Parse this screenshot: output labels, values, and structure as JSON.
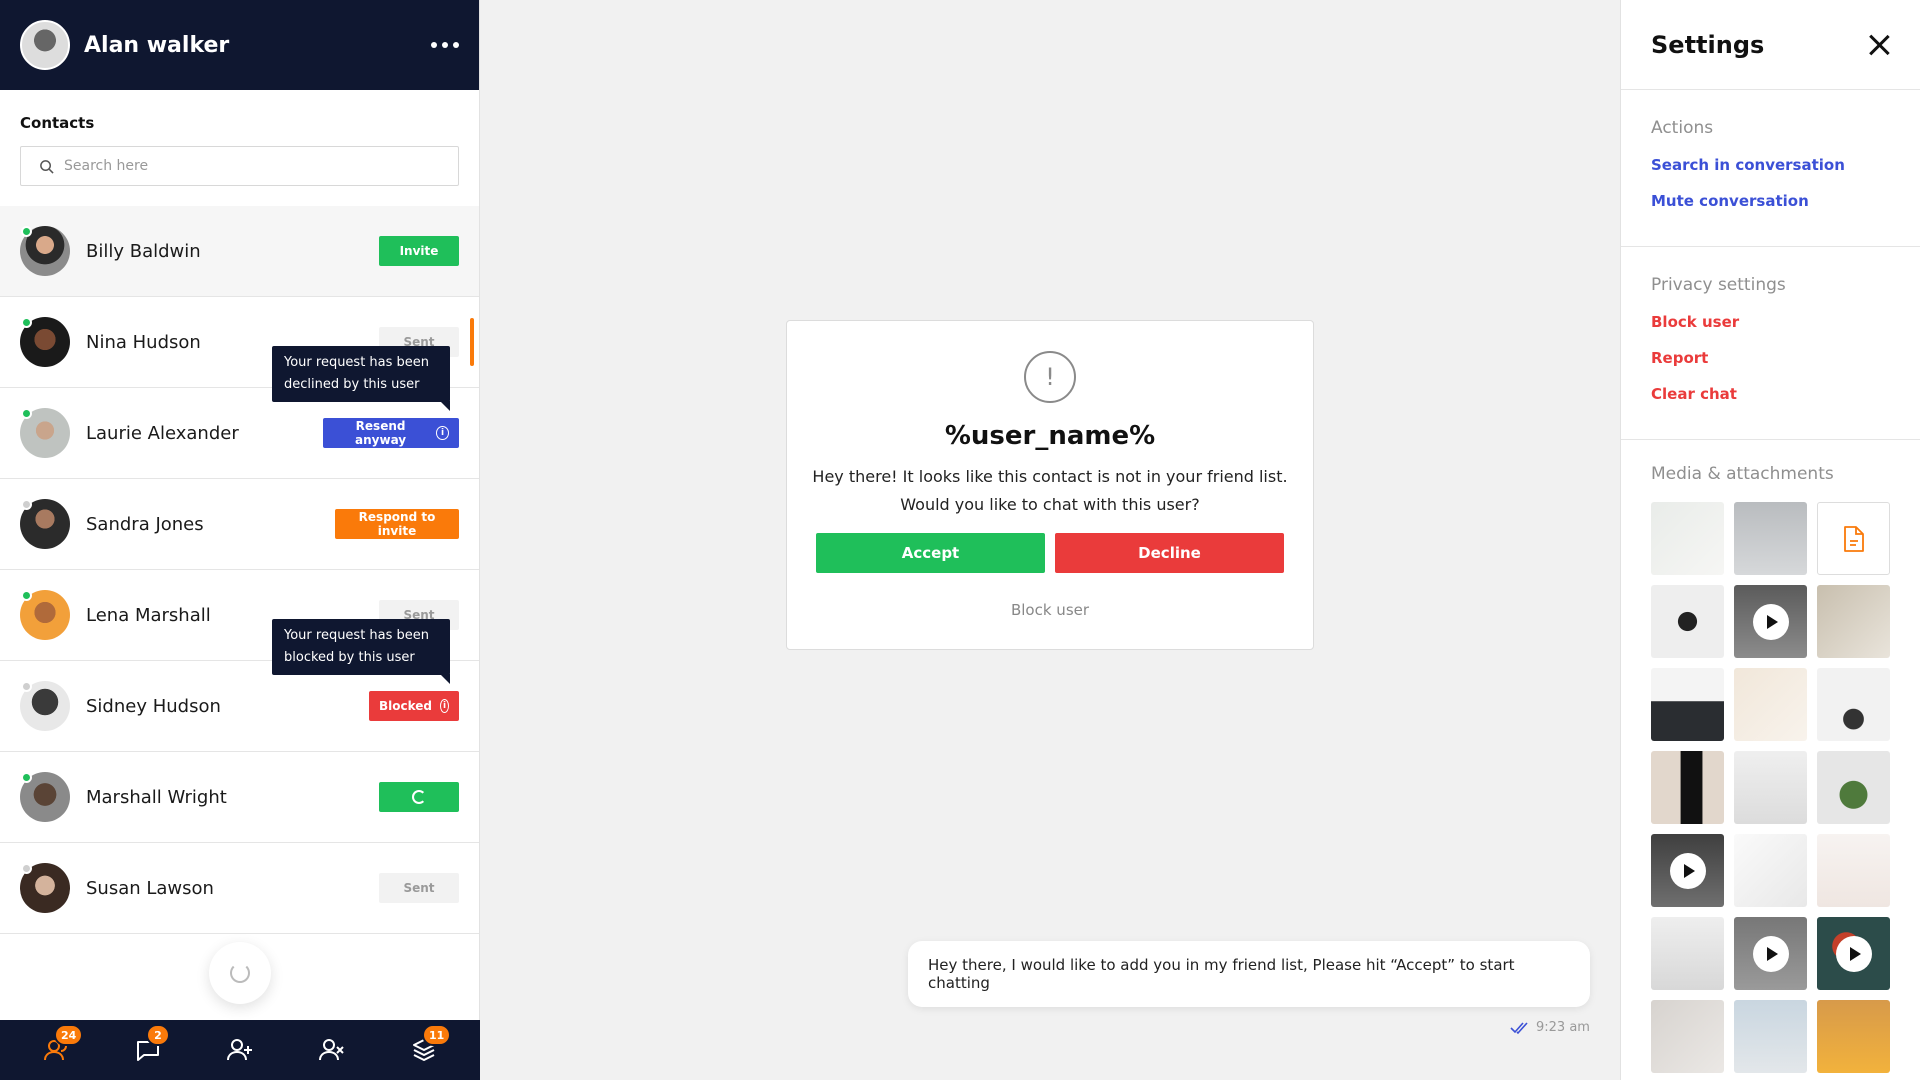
{
  "header": {
    "user_name": "Alan walker"
  },
  "contacts": {
    "title": "Contacts",
    "search_placeholder": "Search here",
    "items": [
      {
        "name": "Billy Baldwin",
        "status": "online",
        "action": "Invite"
      },
      {
        "name": "Nina Hudson",
        "status": "online",
        "action": "Sent"
      },
      {
        "name": "Laurie Alexander",
        "status": "online",
        "action": "Resend anyway"
      },
      {
        "name": "Sandra Jones",
        "status": "offline",
        "action": "Respond to invite"
      },
      {
        "name": "Lena Marshall",
        "status": "online",
        "action": "Sent"
      },
      {
        "name": "Sidney Hudson",
        "status": "offline",
        "action": "Blocked"
      },
      {
        "name": "Marshall Wright",
        "status": "online",
        "action": ""
      },
      {
        "name": "Susan Lawson",
        "status": "offline",
        "action": "Sent"
      }
    ],
    "tooltip_declined": "Your request has been declined by this user",
    "tooltip_blocked": "Your request has been blocked by this user"
  },
  "bottom_nav": [
    {
      "icon": "contacts-icon",
      "badge": "24"
    },
    {
      "icon": "chat-icon",
      "badge": "2"
    },
    {
      "icon": "add-user-icon",
      "badge": ""
    },
    {
      "icon": "remove-user-icon",
      "badge": ""
    },
    {
      "icon": "layers-icon",
      "badge": "11"
    }
  ],
  "dialog": {
    "title": "%user_name%",
    "body_line1": "Hey there! It looks like this contact is not in your friend list.",
    "body_line2": "Would you like to chat with this user?",
    "accept_label": "Accept",
    "decline_label": "Decline",
    "block_label": "Block user"
  },
  "message": {
    "text": "Hey there, I would like to add you in my friend list, Please hit “Accept” to start chatting",
    "time": "9:23 am"
  },
  "settings": {
    "title": "Settings",
    "actions_title": "Actions",
    "search_label": "Search in conversation",
    "mute_label": "Mute conversation",
    "privacy_title": "Privacy settings",
    "block_label": "Block user",
    "report_label": "Report",
    "clear_label": "Clear chat",
    "media_title": "Media & attachments"
  },
  "colors": {
    "navy": "#0f1730",
    "green": "#1fbf5a",
    "red": "#ea3b3b",
    "orange": "#fa7a0a",
    "blue": "#3b50d6"
  }
}
